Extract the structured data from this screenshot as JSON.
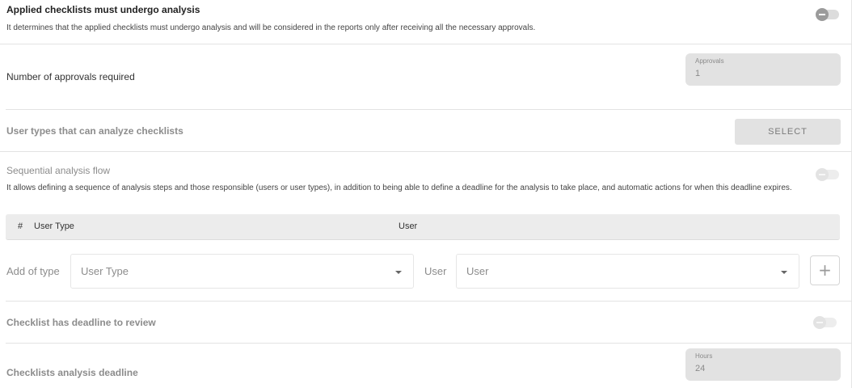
{
  "analysis": {
    "title": "Applied checklists must undergo analysis",
    "description": "It determines that the applied checklists must undergo analysis and will be considered in the reports only after receiving all the necessary approvals."
  },
  "approvals": {
    "label": "Number of approvals required",
    "field_label": "Approvals",
    "field_value": "1"
  },
  "user_types": {
    "label": "User types that can analyze checklists",
    "button": "SELECT"
  },
  "sequential": {
    "title": "Sequential analysis flow",
    "description": "It allows defining a sequence of analysis steps and those responsible (users or user types), in addition to being able to define a deadline for the analysis to take place, and automatic actions for when this deadline expires.",
    "table_headers": [
      "#",
      "User Type",
      "User"
    ],
    "add_of_type_label": "Add of type",
    "user_type_placeholder": "User Type",
    "user_label": "User",
    "user_placeholder": "User",
    "add_button": "+"
  },
  "deadline_review": {
    "title": "Checklist has deadline to review"
  },
  "analysis_deadline": {
    "label": "Checklists analysis deadline",
    "field_label": "Hours",
    "field_value": "24"
  }
}
